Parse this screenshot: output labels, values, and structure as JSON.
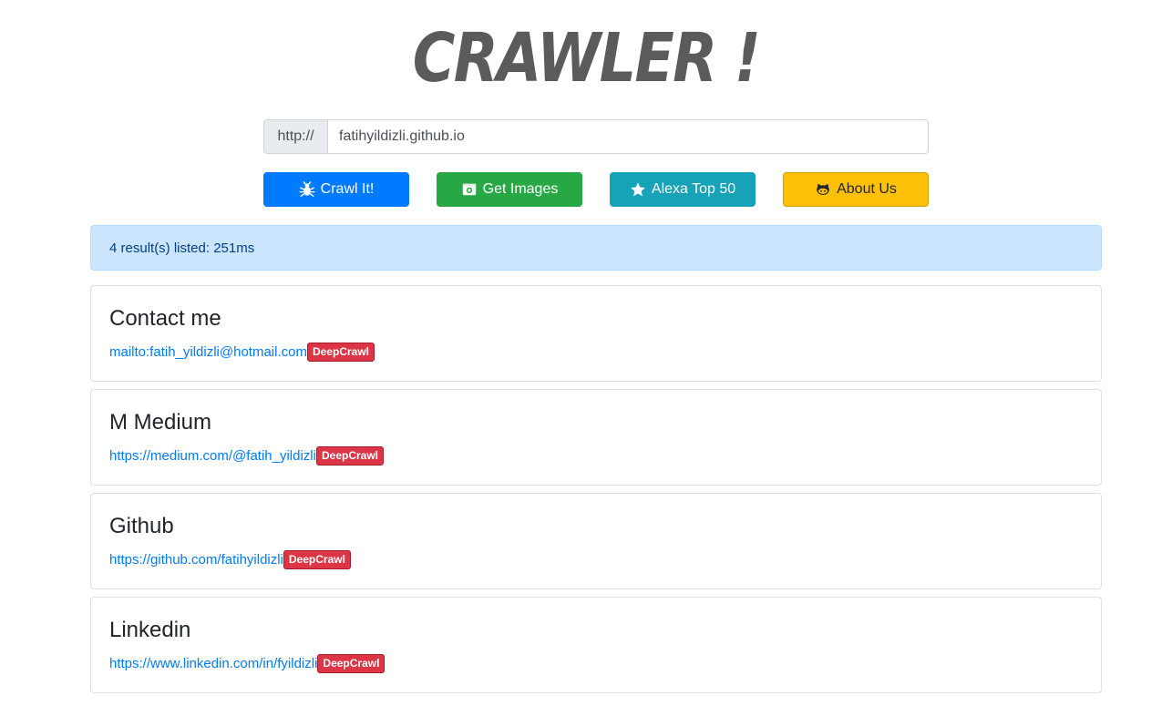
{
  "logo": {
    "text": "CRAWLER !"
  },
  "url_bar": {
    "prefix": "http://",
    "value": "fatihyildizli.github.io"
  },
  "buttons": {
    "crawl": {
      "label": "Crawl It!",
      "icon": "bug-icon",
      "color": "#007bff"
    },
    "images": {
      "label": "Get Images",
      "icon": "camera-icon",
      "color": "#28a745"
    },
    "alexa": {
      "label": "Alexa Top 50",
      "icon": "star-icon",
      "color": "#17a2b8"
    },
    "about": {
      "label": "About Us",
      "icon": "github-icon",
      "color": "#ffc107"
    }
  },
  "alert": {
    "text": "4 result(s) listed: 251ms"
  },
  "results": [
    {
      "title": "Contact me",
      "url": "mailto:fatih_yildizli@hotmail.com",
      "badge": "DeepCrawl"
    },
    {
      "title": "M Medium",
      "url": "https://medium.com/@fatih_yildizli",
      "badge": "DeepCrawl"
    },
    {
      "title": "Github",
      "url": "https://github.com/fatihyildizli",
      "badge": "DeepCrawl"
    },
    {
      "title": "Linkedin",
      "url": "https://www.linkedin.com/in/fyildizli",
      "badge": "DeepCrawl"
    }
  ],
  "colors": {
    "badge": "#dc3545",
    "alert_bg": "#cce5ff",
    "link": "#007bff"
  }
}
